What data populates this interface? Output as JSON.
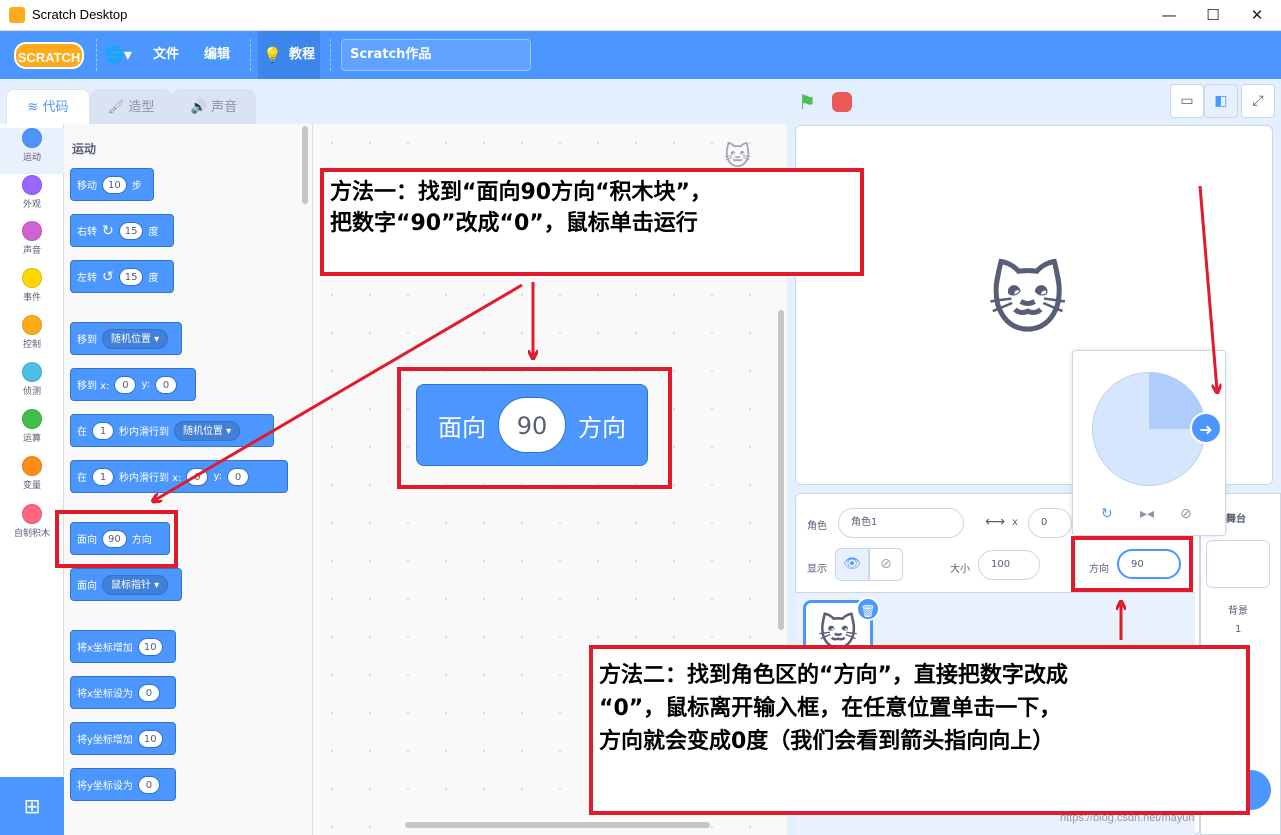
{
  "window": {
    "title": "Scratch Desktop",
    "minimize": "—",
    "maximize": "☐",
    "close": "✕"
  },
  "menubar": {
    "logo": "SCRATCH",
    "language_icon": "🌐▾",
    "file": "文件",
    "edit": "编辑",
    "tutorial_icon": "💡",
    "tutorials": "教程",
    "project_title": "Scratch作品"
  },
  "tabs": [
    {
      "icon": "≋",
      "label": "代码"
    },
    {
      "icon": "🖌",
      "label": "造型"
    },
    {
      "icon": "🔊",
      "label": "声音"
    }
  ],
  "categories": [
    {
      "label": "运动",
      "color": "#4c97ff"
    },
    {
      "label": "外观",
      "color": "#9966ff"
    },
    {
      "label": "声音",
      "color": "#cf63cf"
    },
    {
      "label": "事件",
      "color": "#ffd500"
    },
    {
      "label": "控制",
      "color": "#ffab19"
    },
    {
      "label": "侦测",
      "color": "#4cbfe6"
    },
    {
      "label": "运算",
      "color": "#40bf4a"
    },
    {
      "label": "变量",
      "color": "#ff8c1a"
    },
    {
      "label": "自制积木",
      "color": "#ff6680"
    }
  ],
  "extension_icon": "⊞",
  "palette": {
    "heading": "运动",
    "blocks": {
      "move": {
        "a": "移动",
        "v": "10",
        "b": "步"
      },
      "turn_right": {
        "a": "右转",
        "icon": "↻",
        "v": "15",
        "b": "度"
      },
      "turn_left": {
        "a": "左转",
        "icon": "↺",
        "v": "15",
        "b": "度"
      },
      "goto": {
        "a": "移到",
        "d": "随机位置 ▾"
      },
      "goto_xy": {
        "a": "移到 x:",
        "x": "0",
        "b": "y:",
        "y": "0"
      },
      "glide": {
        "a": "在",
        "v": "1",
        "b": "秒内滑行到",
        "d": "随机位置 ▾"
      },
      "glide_xy": {
        "a": "在",
        "v": "1",
        "b": "秒内滑行到 x:",
        "x": "0",
        "c": "y:",
        "y": "0"
      },
      "point_dir": {
        "a": "面向",
        "v": "90",
        "b": "方向"
      },
      "point_towards": {
        "a": "面向",
        "d": "鼠标指针 ▾"
      },
      "change_x": {
        "a": "将x坐标增加",
        "v": "10"
      },
      "set_x": {
        "a": "将x坐标设为",
        "v": "0"
      },
      "change_y": {
        "a": "将y坐标增加",
        "v": "10"
      },
      "set_y": {
        "a": "将y坐标设为",
        "v": "0"
      }
    }
  },
  "workspace": {
    "block": {
      "a": "面向",
      "v": "90",
      "b": "方向"
    },
    "cat_icon": "🐱"
  },
  "stage_controls": {
    "flag": "⚑",
    "small": "▭",
    "normal": "◧",
    "fullscreen": "⤢"
  },
  "stage": {
    "sprite": "🐱"
  },
  "sprite_info": {
    "sprite_label": "角色",
    "sprite_name": "角色1",
    "x_icon": "⟷",
    "x_label": "x",
    "x_value": "0",
    "show_label": "显示",
    "show_icon": "👁",
    "hide_icon": "⊘",
    "size_label": "大小",
    "size_value": "100",
    "direction_label": "方向",
    "direction_value": "90"
  },
  "sprite_list": {
    "thumb": "🐱",
    "trash": "🗑"
  },
  "stage_tab": {
    "title": "舞台",
    "backdrop_label": "背景",
    "backdrop_count": "1"
  },
  "dial": {
    "knob": "➜",
    "rotate_all": "↻",
    "left_right": "▸◂",
    "dont_rotate": "⊘"
  },
  "callouts": {
    "method1": {
      "line1": "方法一：找到“面向90方向“积木块”，",
      "line2": "把数字“90”改成“0”，鼠标单击运行"
    },
    "method2": {
      "line1": "方法二：找到角色区的“方向”，直接把数字改成",
      "line2": "“0”，鼠标离开输入框，在任意位置单击一下，",
      "line3": "方向就会变成0度（我们会看到箭头指向向上）"
    }
  },
  "watermark": "https://blog.csdn.net/mayun"
}
